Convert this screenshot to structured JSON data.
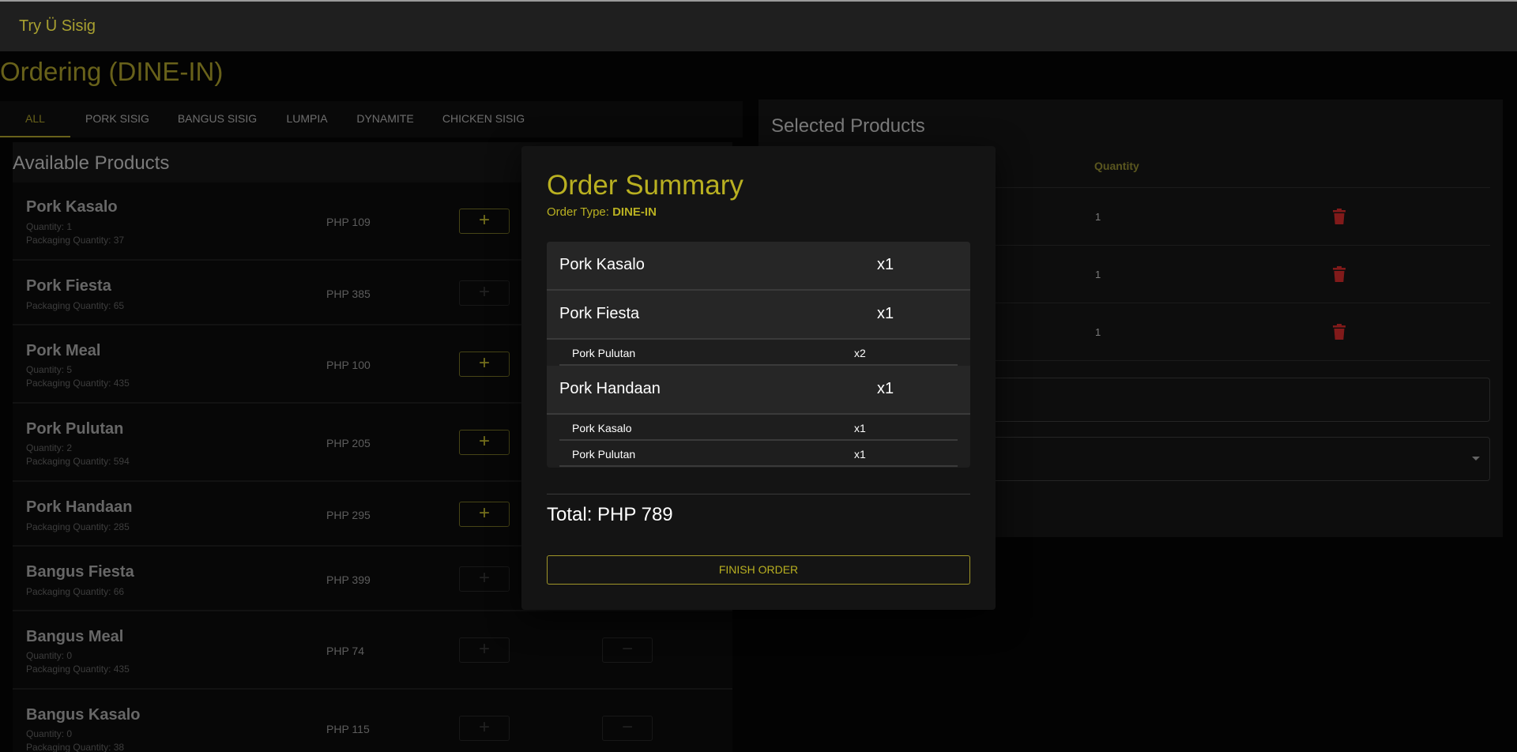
{
  "app": {
    "brand": "Try Ü Sisig"
  },
  "page": {
    "title": "Ordering (DINE-IN)"
  },
  "tabs": [
    {
      "label": "ALL",
      "active": true
    },
    {
      "label": "PORK SISIG"
    },
    {
      "label": "BANGUS SISIG"
    },
    {
      "label": "LUMPIA"
    },
    {
      "label": "DYNAMITE"
    },
    {
      "label": "CHICKEN SISIG"
    }
  ],
  "products": {
    "title": "Available Products",
    "items": [
      {
        "name": "Pork Kasalo",
        "quantity": "Quantity: 1",
        "packaging": "Packaging Quantity: 37",
        "price": "PHP 109",
        "add_icon": "plus-icon",
        "add_enabled": true
      },
      {
        "name": "Pork Fiesta",
        "packaging": "Packaging Quantity: 65",
        "price": "PHP 385",
        "add_icon": "plus-icon",
        "add_enabled": false
      },
      {
        "name": "Pork Meal",
        "quantity": "Quantity: 5",
        "packaging": "Packaging Quantity: 435",
        "price": "PHP 100",
        "add_icon": "plus-icon",
        "add_enabled": true
      },
      {
        "name": "Pork Pulutan",
        "quantity": "Quantity: 2",
        "packaging": "Packaging Quantity: 594",
        "price": "PHP 205",
        "add_icon": "plus-icon",
        "add_enabled": true
      },
      {
        "name": "Pork Handaan",
        "packaging": "Packaging Quantity: 285",
        "price": "PHP 295",
        "add_icon": "plus-icon",
        "add_enabled": true
      },
      {
        "name": "Bangus Fiesta",
        "packaging": "Packaging Quantity: 66",
        "price": "PHP 399",
        "add_icon": "plus-icon",
        "add_enabled": false
      },
      {
        "name": "Bangus Meal",
        "quantity": "Quantity: 0",
        "packaging": "Packaging Quantity: 435",
        "price": "PHP 74",
        "add_icon": "plus-icon",
        "remove_icon": "minus-icon",
        "add_enabled": false
      },
      {
        "name": "Bangus Kasalo",
        "quantity": "Quantity: 0",
        "packaging": "Packaging Quantity: 38",
        "price": "PHP 115",
        "add_icon": "plus-icon",
        "remove_icon": "minus-icon",
        "add_enabled": false
      }
    ]
  },
  "selected": {
    "title": "Selected Products",
    "quantity_header": "Quantity",
    "rows": [
      {
        "quantity": "1",
        "delete_icon": "trash-icon"
      },
      {
        "quantity": "1",
        "delete_icon": "trash-icon"
      },
      {
        "quantity": "1",
        "delete_icon": "trash-icon"
      }
    ]
  },
  "summary": {
    "title": "Order Summary",
    "order_type_label": "Order Type: ",
    "order_type": "DINE-IN",
    "items": [
      {
        "name": "Pork Kasalo",
        "qty": "x1",
        "subs": []
      },
      {
        "name": "Pork Fiesta",
        "qty": "x1",
        "subs": [
          {
            "name": "Pork Pulutan",
            "qty": "x2"
          }
        ]
      },
      {
        "name": "Pork Handaan",
        "qty": "x1",
        "subs": [
          {
            "name": "Pork Kasalo",
            "qty": "x1"
          },
          {
            "name": "Pork Pulutan",
            "qty": "x1"
          }
        ]
      }
    ],
    "total": "Total: PHP 789",
    "finish_label": "FINISH ORDER"
  },
  "colors": {
    "accent": "#b9b021",
    "delete": "#c62828",
    "background": "#050505"
  }
}
